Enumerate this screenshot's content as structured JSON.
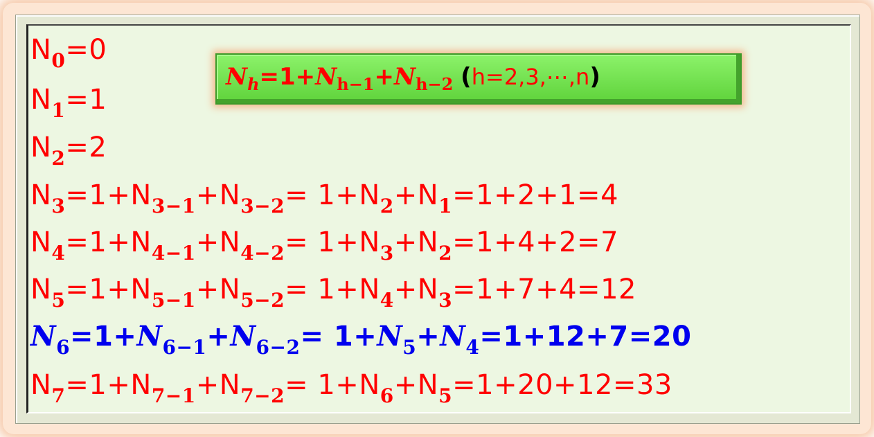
{
  "colors": {
    "text": "#ff0000",
    "highlight": "#0000ee",
    "box": "#6ee048",
    "background": "#edf7e2"
  },
  "recurrence": {
    "lhs_main": "N",
    "lhs_sub": "h",
    "eq": "=1+",
    "t1_main": "N",
    "t1_sub": "h−1",
    "plus": "+",
    "t2_main": "N",
    "t2_sub": "h−2",
    "open": "(",
    "range": "h=2,3,⋯,n",
    "close": ")"
  },
  "lines": [
    {
      "lhs": "N",
      "lhs_sub": "0",
      "text": "=0"
    },
    {
      "lhs": "N",
      "lhs_sub": "1",
      "text": "=1"
    },
    {
      "lhs": "N",
      "lhs_sub": "2",
      "text": "=2"
    },
    {
      "lhs": "N",
      "lhs_sub": "3",
      "a": "=1+",
      "b": "N",
      "b_sub": "3−1",
      "c": "+",
      "d": "N",
      "d_sub": "3−2",
      "e": "= 1+",
      "f": "N",
      "f_sub": "2",
      "g": "+",
      "h": "N",
      "h_sub": "1",
      "result": "=1+2+1=4"
    },
    {
      "lhs": "N",
      "lhs_sub": "4",
      "a": "=1+",
      "b": "N",
      "b_sub": "4−1",
      "c": "+",
      "d": "N",
      "d_sub": "4−2",
      "e": "= 1+",
      "f": "N",
      "f_sub": "3",
      "g": "+",
      "h": "N",
      "h_sub": "2",
      "result": "=1+4+2=7"
    },
    {
      "lhs": "N",
      "lhs_sub": "5",
      "a": "=1+",
      "b": "N",
      "b_sub": "5−1",
      "c": "+",
      "d": "N",
      "d_sub": "5−2",
      "e": "= 1+",
      "f": "N",
      "f_sub": "4",
      "g": "+",
      "h": "N",
      "h_sub": "3",
      "result": "=1+7+4=12"
    },
    {
      "lhs": "N",
      "lhs_sub": "6",
      "a": "=1+",
      "b": "N",
      "b_sub": "6−1",
      "c": "+",
      "d": "N",
      "d_sub": "6−2",
      "e": "= 1+",
      "f": "N",
      "f_sub": "5",
      "g": "+",
      "h": "N",
      "h_sub": "4",
      "result": "=1+12+7=20"
    },
    {
      "lhs": "N",
      "lhs_sub": "7",
      "a": "=1+",
      "b": "N",
      "b_sub": "7−1",
      "c": "+",
      "d": "N",
      "d_sub": "7−2",
      "e": "= 1+",
      "f": "N",
      "f_sub": "6",
      "g": "+",
      "h": "N",
      "h_sub": "5",
      "result": "=1+20+12=33"
    }
  ]
}
